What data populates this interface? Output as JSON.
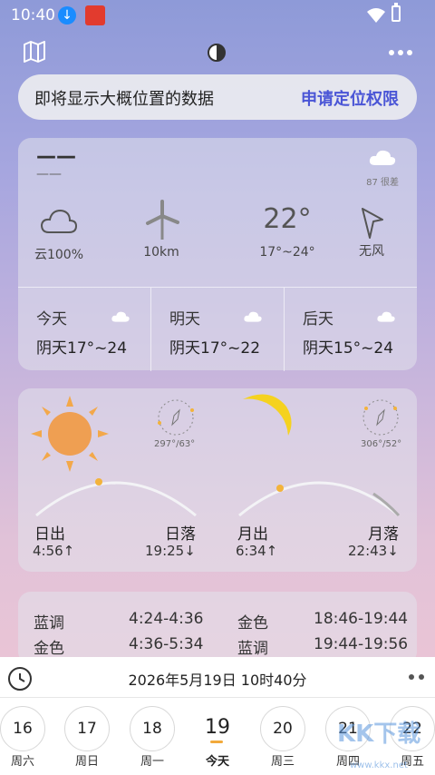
{
  "status": {
    "time": "10:40"
  },
  "banner": {
    "message": "即将显示大概位置的数据",
    "action": "申请定位权限"
  },
  "current": {
    "city": "——",
    "city_sub": "——",
    "aqi": "87 很差",
    "cloud": "云100%",
    "wind_speed": "10km",
    "temp": "22°",
    "temp_range": "17°~24°",
    "wind_dir": "无风"
  },
  "forecast": [
    {
      "day": "今天",
      "value": "阴天17°~24"
    },
    {
      "day": "明天",
      "value": "阴天17°~22"
    },
    {
      "day": "后天",
      "value": "阴天15°~24"
    }
  ],
  "sun": {
    "compass": "297°/63°",
    "rise_label": "日出",
    "rise_time": "4:56↑",
    "set_label": "日落",
    "set_time": "19:25↓"
  },
  "moon": {
    "compass": "306°/52°",
    "rise_label": "月出",
    "rise_time": "6:34↑",
    "set_label": "月落",
    "set_time": "22:43↓"
  },
  "twilight": [
    {
      "name": "蓝调",
      "range": "4:24-4:36"
    },
    {
      "name": "金色",
      "range": "4:36-5:34"
    },
    {
      "name": "金色",
      "range": "18:46-19:44"
    },
    {
      "name": "蓝调",
      "range": "19:44-19:56"
    }
  ],
  "bottom": {
    "datetime": "2026年5月19日  10时40分",
    "days": [
      {
        "num": "16",
        "week": "周六"
      },
      {
        "num": "17",
        "week": "周日"
      },
      {
        "num": "18",
        "week": "周一"
      },
      {
        "num": "19",
        "week": "今天"
      },
      {
        "num": "20",
        "week": "周三"
      },
      {
        "num": "21",
        "week": "周四"
      },
      {
        "num": "22",
        "week": "周五"
      }
    ]
  },
  "watermark": {
    "brand": "KK下载",
    "url": "www.kkx.net"
  }
}
